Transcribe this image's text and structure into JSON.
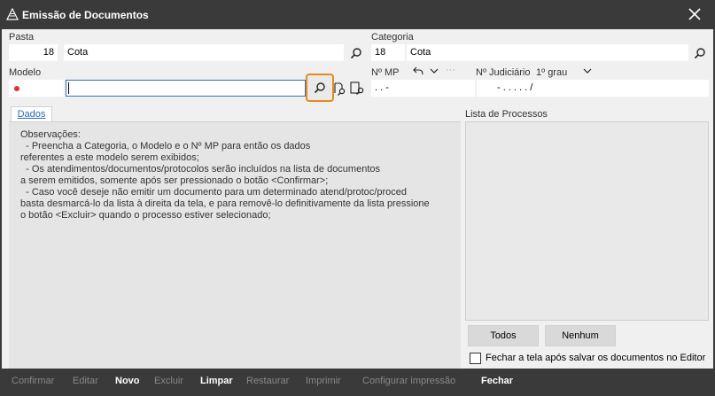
{
  "window": {
    "title": "Emissão de Documentos"
  },
  "pasta": {
    "label": "Pasta",
    "code": "18",
    "name": "Cota"
  },
  "categoria": {
    "label": "Categoria",
    "code": "18",
    "name": "Cota"
  },
  "modelo": {
    "label": "Modelo",
    "code": "",
    "name": ""
  },
  "nmp": {
    "label": "Nº MP",
    "value": ".   .      -",
    "extra": "···"
  },
  "judiciario": {
    "label": "Nº Judiciário",
    "grau": "1º grau",
    "value": "-  .     .  . . .      /"
  },
  "tabs": {
    "dados": "Dados"
  },
  "observacoes": {
    "lines": [
      "Observações:",
      "  - Preencha a Categoria, o Modelo e o Nº MP para então os dados",
      "referentes a este modelo serem exibidos;",
      "  - Os atendimentos/documentos/protocolos serão incluídos na lista de documentos",
      "a serem emitidos, somente após ser pressionado o botão <Confirmar>;",
      "  - Caso você deseje não emitir um documento para um determinado atend/protoc/proced",
      "basta desmarcá-lo da lista à direita da tela, e para removê-lo definitivamente da lista pressione",
      "o botão <Excluir> quando o processo estiver selecionado;"
    ]
  },
  "processos": {
    "label": "Lista de Processos",
    "todos": "Todos",
    "nenhum": "Nenhum",
    "fechar_checkbox": "Fechar a tela após salvar os documentos no Editor",
    "fechar_checked": false
  },
  "footer": {
    "confirmar": "Confirmar",
    "editar": "Editar",
    "novo": "Novo",
    "excluir": "Excluir",
    "limpar": "Limpar",
    "restaurar": "Restaurar",
    "imprimir": "Imprimir",
    "configurar": "Configurar impressão",
    "fechar": "Fechar"
  },
  "colors": {
    "titlebar": "#3a3a3a",
    "client": "#f0f0f0",
    "highlight": "#e8891a",
    "required_dot": "#e0303a",
    "tab_text": "#2a6bb3"
  }
}
